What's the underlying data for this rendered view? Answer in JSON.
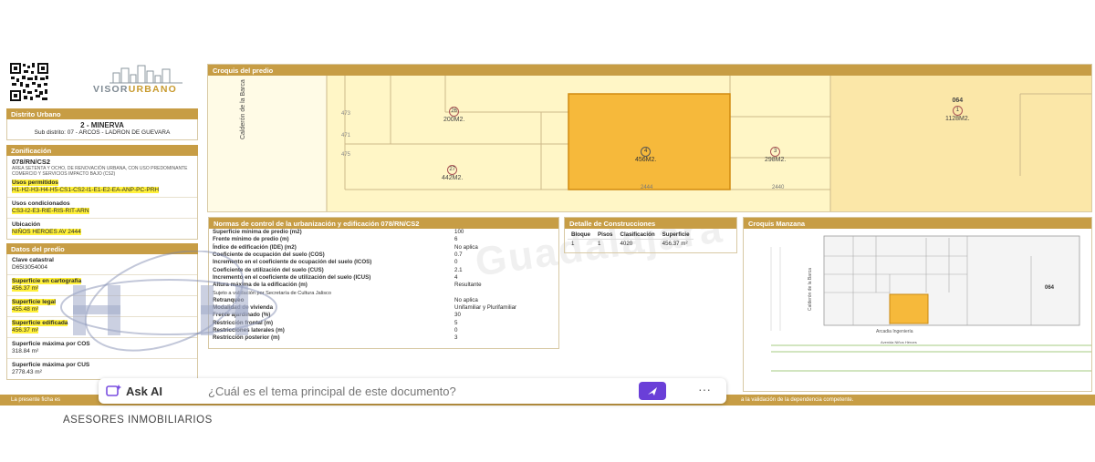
{
  "brand": {
    "name_a": "VISOR",
    "name_b": "URBANO"
  },
  "distrito": {
    "header": "Distrito Urbano",
    "title": "2 - MINERVA",
    "sub": "Sub distrito: 07 - ARCOS - LADRON DE GUEVARA"
  },
  "zonificacion": {
    "header": "Zonificación",
    "code": "078/RN/CS2",
    "desc": "AREA SETENTA Y OCHO, DE RENOVACIÓN URBANA, CON USO PREDOMINANTE COMERCIO Y SERVICIOS IMPACTO BAJO (CS2)",
    "usos_permitidos_label": "Usos permitidos",
    "usos_permitidos": "H1-H2-H3-H4-H5-CS1-CS2-I1-E1-E2-EA-ANP-PC-PRH",
    "usos_condicionados_label": "Usos condicionados",
    "usos_condicionados": "CS3-I2-E3-RIE-RIS-RIT-ARN",
    "ubicacion_label": "Ubicación",
    "ubicacion": "NIÑOS HEROES AV 2444"
  },
  "datos": {
    "header": "Datos del predio",
    "clave_label": "Clave catastral",
    "clave": "D65I3054004",
    "sup_carto_label": "Superficie en cartografía",
    "sup_carto": "456.37 m²",
    "sup_legal_label": "Superficie legal",
    "sup_legal": "455.48 m²",
    "sup_edif_label": "Superficie edificada",
    "sup_edif": "456.37 m²",
    "sup_cos_label": "Superficie máxima por COS",
    "sup_cos": "318.84 m²",
    "sup_cus_label": "Superficie máxima por CUS",
    "sup_cus": "2778.43 m²"
  },
  "croquis_predio": {
    "header": "Croquis del predio",
    "street": "Calderón de la Barca",
    "lots": [
      {
        "num": "26",
        "area": "200M2."
      },
      {
        "num": "27",
        "area": "442M2."
      },
      {
        "num": "4",
        "area": "456M2."
      },
      {
        "num": "3",
        "area": "298M2."
      },
      {
        "num": "1",
        "area": "1128M2."
      }
    ],
    "block_label": "064",
    "side_nums": [
      "473",
      "471",
      "475"
    ],
    "bottom_nums": [
      "2444",
      "2440"
    ]
  },
  "normas": {
    "header": "Normas de control de la urbanización y edificación 078/RN/CS2",
    "rows": [
      {
        "k": "Superficie mínima de predio (m2)",
        "v": "100"
      },
      {
        "k": "Frente mínimo de predio (m)",
        "v": "6"
      },
      {
        "k": "Índice de edificación (IDE) (m2)",
        "v": "No aplica"
      },
      {
        "k": "Coeficiente de ocupación del suelo (COS)",
        "v": "0.7"
      },
      {
        "k": "Incremento en el coeficiente de ocupación del suelo (ICOS)",
        "v": "0"
      },
      {
        "k": "Coeficiente de utilización del suelo (CUS)",
        "v": "2.1"
      },
      {
        "k": "Incremento en el coeficiente de utilización del suelo (ICUS)",
        "v": "4"
      },
      {
        "k": "Altura máxima de la edificación (m)",
        "v": "Resultante"
      },
      {
        "k": "Sujeto a validación por Secretaría de Cultura Jalisco",
        "v": ""
      },
      {
        "k": "Retranqueo",
        "v": "No aplica"
      },
      {
        "k": "Modalidad de vivienda",
        "v": "Unifamiliar y Plurifamiliar"
      },
      {
        "k": "Frente ajardinado (%)",
        "v": "30"
      },
      {
        "k": "Restricción frontal (m)",
        "v": "5"
      },
      {
        "k": "Restricciones laterales (m)",
        "v": "0"
      },
      {
        "k": "Restricción posterior (m)",
        "v": "3"
      }
    ]
  },
  "detalle": {
    "header": "Detalle de Construcciones",
    "columns": [
      "Bloque",
      "Pisos",
      "Clasificación",
      "Superficie"
    ],
    "rows": [
      [
        "1",
        "1",
        "4020",
        "456.37 m²"
      ]
    ]
  },
  "manzana": {
    "header": "Croquis Manzana",
    "street_v": "Calderón de la Barca",
    "street_a": "Arcadia Ingeniería",
    "street_b": "Avenida Niños Héroes",
    "block_label": "064"
  },
  "footer": {
    "left": "La presente ficha es",
    "right": "a la validación de la dependencia competente."
  },
  "watermark": "Guadalajara",
  "ask": {
    "button": "Ask AI",
    "placeholder": "¿Cuál es el tema principal de este documento?",
    "more": "···"
  },
  "agency": "ASESORES INMOBILIARIOS",
  "colors": {
    "accent": "#c79d45",
    "highlight": "#fff03a",
    "lot_selected": "#f6b93b",
    "send": "#6a3fd8"
  }
}
